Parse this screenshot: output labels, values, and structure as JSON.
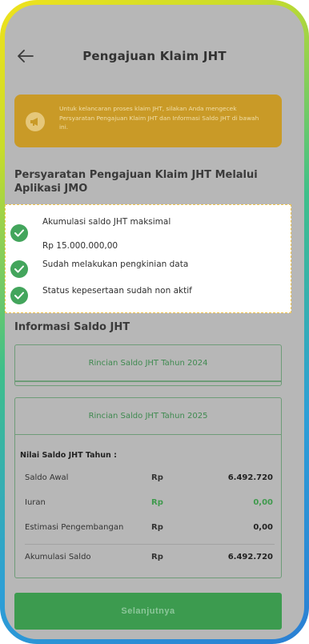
{
  "header": {
    "back_icon": "arrow-left-icon",
    "title": "Pengajuan Klaim JHT"
  },
  "notice": {
    "icon": "megaphone-icon",
    "text": "Untuk kelancaran proses klaim JHT, silakan Anda mengecek Persyaratan Pengajuan Klaim JHT dan Informasi Saldo JHT di bawah ini."
  },
  "requirements": {
    "title": "Persyaratan Pengajuan Klaim JHT Melalui Aplikasi JMO",
    "items": [
      {
        "label": "Akumulasi saldo JHT maksimal",
        "sub": "Rp 15.000.000,00"
      },
      {
        "label": "Sudah melakukan pengkinian data"
      },
      {
        "label": "Status kepesertaan sudah non aktif"
      }
    ]
  },
  "saldo": {
    "title": "Informasi Saldo JHT",
    "card_2024": {
      "label": "Rincian Saldo JHT Tahun 2024"
    },
    "card_2025": {
      "label": "Rincian Saldo JHT Tahun 2025",
      "nilai_title": "Nilai Saldo JHT Tahun :",
      "rows": [
        {
          "label": "Saldo Awal",
          "currency": "Rp",
          "value": "6.492.720"
        },
        {
          "label": "Iuran",
          "currency": "Rp",
          "value": "0,00"
        },
        {
          "label": "Estimasi Pengembangan",
          "currency": "Rp",
          "value": "0,00"
        },
        {
          "label": "Akumulasi Saldo",
          "currency": "Rp",
          "value": "6.492.720"
        }
      ]
    }
  },
  "footer": {
    "next_label": "Selanjutnya"
  },
  "colors": {
    "accent_green": "#3c9b4f",
    "notice_gold": "#c99a27",
    "check_green": "#43a55c"
  }
}
